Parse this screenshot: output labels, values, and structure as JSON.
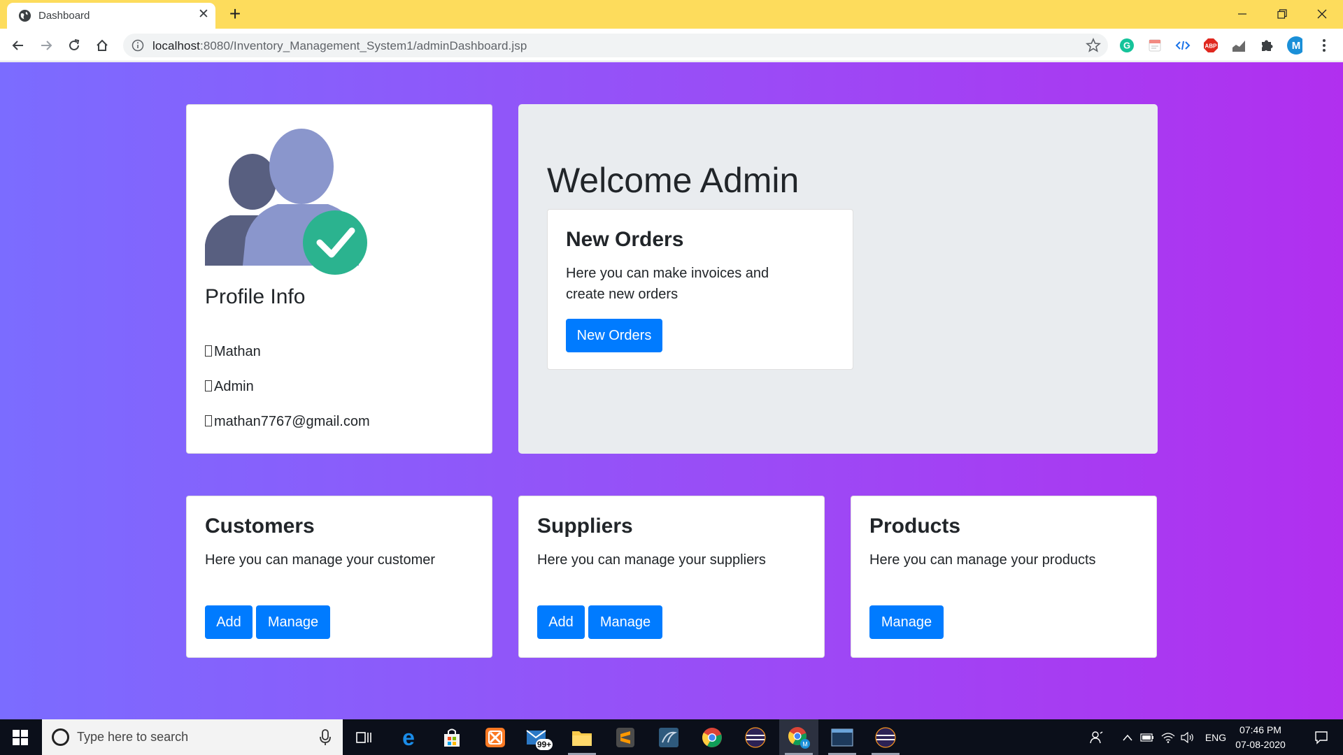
{
  "browser": {
    "tab_title": "Dashboard",
    "url_host": "localhost",
    "url_rest": ":8080/Inventory_Management_System1/adminDashboard.jsp",
    "profile_initial": "M",
    "abp_label": "ABP"
  },
  "profile": {
    "title": "Profile Info",
    "name": "Mathan",
    "role": "Admin",
    "email": "mathan7767@gmail.com"
  },
  "welcome": {
    "heading": "Welcome Admin",
    "orders_title": "New Orders",
    "orders_text": "Here you can make invoices and create new orders",
    "orders_button": "New Orders"
  },
  "customers": {
    "title": "Customers",
    "text": "Here you can manage your customer",
    "add_button": "Add",
    "manage_button": "Manage"
  },
  "suppliers": {
    "title": "Suppliers",
    "text": "Here you can manage your suppliers",
    "add_button": "Add",
    "manage_button": "Manage"
  },
  "products": {
    "title": "Products",
    "text": "Here you can manage your products",
    "manage_button": "Manage"
  },
  "taskbar": {
    "search_placeholder": "Type here to search",
    "mail_badge": "99+",
    "language": "ENG",
    "time": "07:46 PM",
    "date": "07-08-2020"
  },
  "colors": {
    "primary": "#007bff",
    "tabbar": "#fddc5c",
    "gradient_start": "#7b6cff",
    "gradient_end": "#b12fef",
    "jumbotron": "#e9ecef"
  }
}
